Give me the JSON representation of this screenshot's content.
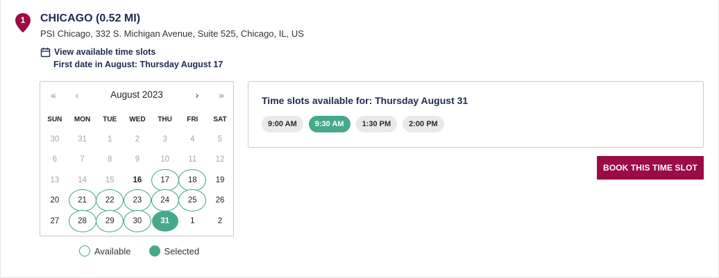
{
  "location": {
    "marker_number": "1",
    "title": "CHICAGO (0.52 MI)",
    "address": "PSI Chicago, 332 S. Michigan Avenue, Suite 525, Chicago, IL, US",
    "view_slots_label": "View available time slots",
    "first_date_text": "First date in August: Thursday August 17"
  },
  "calendar": {
    "month_label": "August 2023",
    "nav": {
      "prev_year": "«",
      "prev_month": "‹",
      "next_month": "›",
      "next_year": "»"
    },
    "weekdays": [
      "SUN",
      "MON",
      "TUE",
      "WED",
      "THU",
      "FRI",
      "SAT"
    ],
    "weeks": [
      [
        {
          "d": "30",
          "s": "muted"
        },
        {
          "d": "31",
          "s": "muted"
        },
        {
          "d": "1",
          "s": "muted"
        },
        {
          "d": "2",
          "s": "muted"
        },
        {
          "d": "3",
          "s": "muted"
        },
        {
          "d": "4",
          "s": "muted"
        },
        {
          "d": "5",
          "s": "muted"
        }
      ],
      [
        {
          "d": "6",
          "s": "muted"
        },
        {
          "d": "7",
          "s": "muted"
        },
        {
          "d": "8",
          "s": "muted"
        },
        {
          "d": "9",
          "s": "muted"
        },
        {
          "d": "10",
          "s": "muted"
        },
        {
          "d": "11",
          "s": "muted"
        },
        {
          "d": "12",
          "s": "muted"
        }
      ],
      [
        {
          "d": "13",
          "s": "muted"
        },
        {
          "d": "14",
          "s": "muted"
        },
        {
          "d": "15",
          "s": "muted"
        },
        {
          "d": "16",
          "s": "today"
        },
        {
          "d": "17",
          "s": "available"
        },
        {
          "d": "18",
          "s": "available"
        },
        {
          "d": "19",
          "s": "normal"
        }
      ],
      [
        {
          "d": "20",
          "s": "normal"
        },
        {
          "d": "21",
          "s": "available"
        },
        {
          "d": "22",
          "s": "available"
        },
        {
          "d": "23",
          "s": "available"
        },
        {
          "d": "24",
          "s": "available"
        },
        {
          "d": "25",
          "s": "available"
        },
        {
          "d": "26",
          "s": "normal"
        }
      ],
      [
        {
          "d": "27",
          "s": "normal"
        },
        {
          "d": "28",
          "s": "available"
        },
        {
          "d": "29",
          "s": "available"
        },
        {
          "d": "30",
          "s": "available"
        },
        {
          "d": "31",
          "s": "selected"
        },
        {
          "d": "1",
          "s": "normal"
        },
        {
          "d": "2",
          "s": "normal"
        }
      ]
    ]
  },
  "legend": {
    "available": "Available",
    "selected": "Selected"
  },
  "time_slots": {
    "title": "Time slots available for: Thursday August 31",
    "slots": [
      {
        "label": "9:00 AM",
        "active": false
      },
      {
        "label": "9:30 AM",
        "active": true
      },
      {
        "label": "1:30 PM",
        "active": false
      },
      {
        "label": "2:00 PM",
        "active": false
      }
    ]
  },
  "book_button": "BOOK THIS TIME SLOT",
  "colors": {
    "brand": "#9b0b46",
    "accent_green": "#46a98b",
    "navy_text": "#1d2b4f"
  }
}
